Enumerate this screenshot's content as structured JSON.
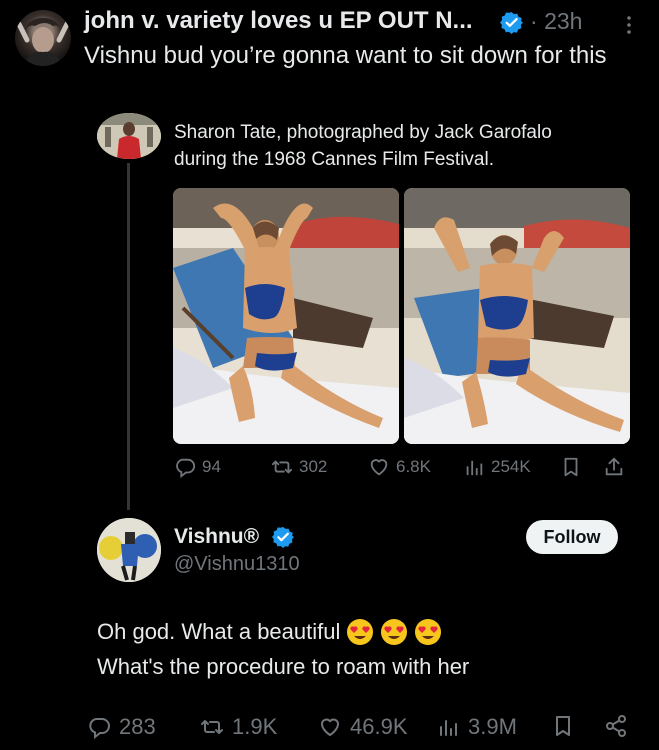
{
  "retweet_source": {
    "author_name": "john v. variety loves u EP OUT N...",
    "separator": "·",
    "time": "23h",
    "text": "Vishnu bud you’re gonna want to sit down for this"
  },
  "quoted_post": {
    "text_line1": "Sharon Tate, photographed by Jack Garofalo",
    "text_line2": "during the 1968 Cannes Film Festival.",
    "metrics": {
      "replies": "94",
      "reposts": "302",
      "likes": "6.8K",
      "views": "254K"
    }
  },
  "reply_post": {
    "author_name": "Vishnu®",
    "handle": "@Vishnu1310",
    "follow_label": "Follow",
    "text_line1": "Oh god. What a beautiful",
    "emoji_count": 3,
    "text_line2": "What's the procedure to roam with her",
    "metrics": {
      "replies": "283",
      "reposts": "1.9K",
      "likes": "46.9K",
      "views": "3.9M"
    }
  },
  "colors": {
    "background": "#000000",
    "text": "#e7e9ea",
    "muted": "#71767b",
    "verified": "#1d9bf0",
    "thread_line": "#333639"
  }
}
